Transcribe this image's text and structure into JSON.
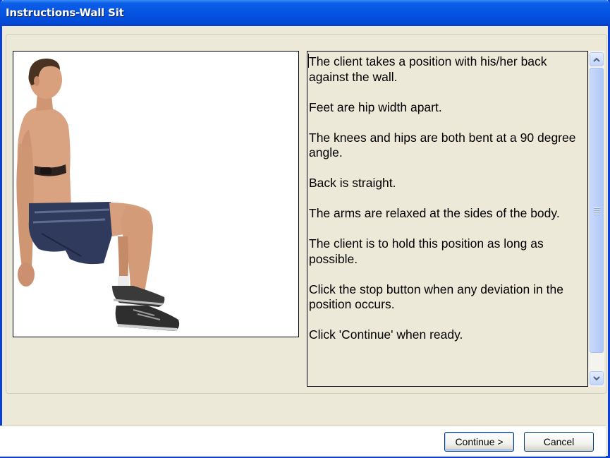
{
  "window": {
    "title": "Instructions-Wall Sit"
  },
  "image": {
    "alt": "Man demonstrating wall sit exercise"
  },
  "instructions": {
    "paragraphs": [
      "The client takes a position with his/her back against the wall.",
      "Feet are hip width apart.",
      "The knees and hips are both bent at a 90 degree angle.",
      "Back is straight.",
      "The arms are relaxed at the sides of the body.",
      "The client is to hold this position as long as possible.",
      "Click the stop button when any deviation in the position occurs.",
      "Click 'Continue' when ready."
    ]
  },
  "buttons": {
    "continue_label": "Continue >",
    "cancel_label": "Cancel"
  },
  "colors": {
    "titlebar": "#0554e3",
    "window_bg": "#ece9d8",
    "button_border": "#003c74"
  }
}
